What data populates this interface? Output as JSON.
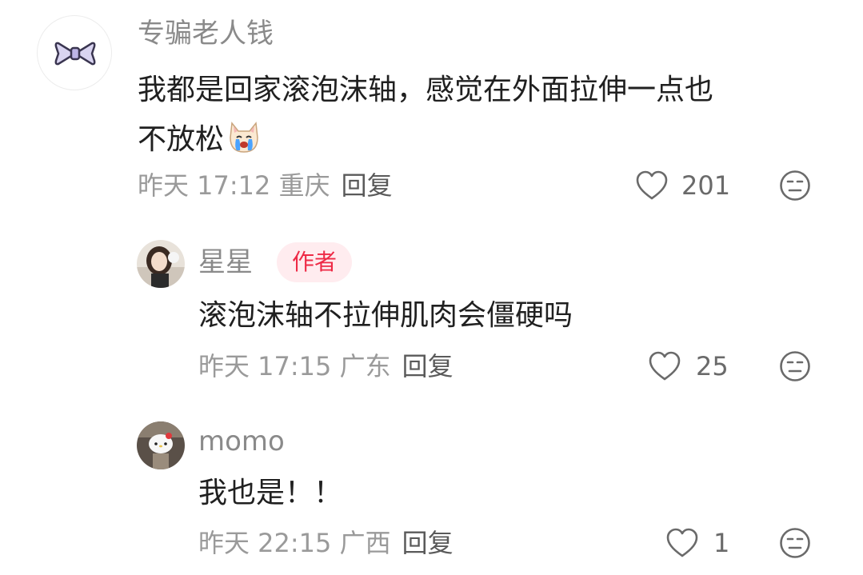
{
  "comments": [
    {
      "username": "专骗老人钱",
      "line1": "我都是回家滚泡沫轴，感觉在外面拉伸一点也",
      "line2": "不放松",
      "meta": "昨天 17:12 重庆",
      "reply_label": "回复",
      "likes": "201"
    }
  ],
  "replies": [
    {
      "username": "星星",
      "badge": "作者",
      "text": "滚泡沫轴不拉伸肌肉会僵硬吗",
      "meta": "昨天 17:15 广东",
      "reply_label": "回复",
      "likes": "25"
    },
    {
      "username": "momo",
      "text": "我也是！！",
      "meta": "昨天 22:15 广西",
      "reply_label": "回复",
      "likes": "1"
    }
  ],
  "colors": {
    "accent": "#ee2a46",
    "badge_bg": "#ffecef",
    "text": "#202020",
    "muted": "#9a9a9a"
  },
  "icons": [
    "bow-icon",
    "crying-dog-emoji",
    "heart-icon",
    "dislike-face-icon"
  ]
}
